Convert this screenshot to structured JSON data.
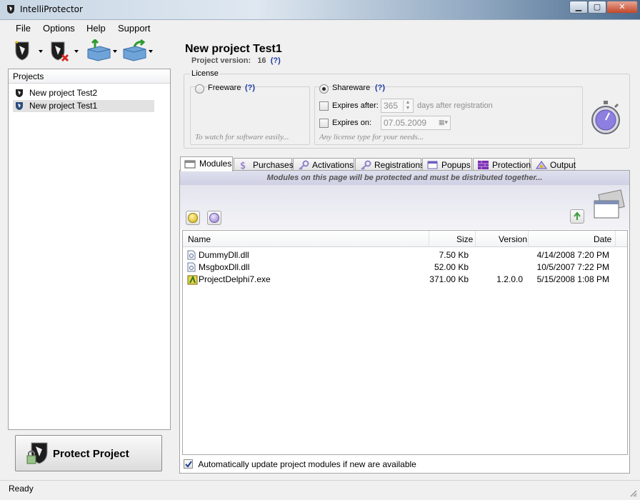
{
  "window": {
    "title": "IntelliProtector",
    "min_glyph": "▁",
    "max_glyph": "▢",
    "close_glyph": "✕"
  },
  "menu": [
    "File",
    "Options",
    "Help",
    "Support"
  ],
  "toolbar": {
    "icons": [
      "new-project-icon",
      "remove-project-icon",
      "open-project-icon",
      "save-project-icon"
    ]
  },
  "projects": {
    "header": "Projects",
    "items": [
      {
        "label": "New project Test2",
        "selected": false
      },
      {
        "label": "New project Test1",
        "selected": true
      }
    ]
  },
  "protect_button": "Protect Project",
  "project": {
    "title": "New project Test1",
    "version_label": "Project version:",
    "version_value": "16",
    "help": "(?)"
  },
  "license": {
    "title": "License",
    "freeware": {
      "label": "Freeware",
      "help": "(?)",
      "note": "To watch for software easily...",
      "selected": false
    },
    "shareware": {
      "label": "Shareware",
      "help": "(?)",
      "selected": true,
      "expires_after_label": "Expires after:",
      "expires_after_value": "365",
      "expires_after_suffix": "days after  registration",
      "expires_on_label": "Expires on:",
      "expires_on_value": "07.05.2009",
      "note": "Any license type for your needs..."
    }
  },
  "tabs": [
    {
      "label": "Modules",
      "icon": "modules-icon",
      "active": true
    },
    {
      "label": "Purchases",
      "icon": "dollar-icon",
      "active": false
    },
    {
      "label": "Activations",
      "icon": "key-icon",
      "active": false
    },
    {
      "label": "Registrations",
      "icon": "key-icon",
      "active": false
    },
    {
      "label": "Popups",
      "icon": "popup-window-icon",
      "active": false
    },
    {
      "label": "Protection",
      "icon": "wall-icon",
      "active": false
    },
    {
      "label": "Output",
      "icon": "output-icon",
      "active": false
    }
  ],
  "modules": {
    "banner": "Modules on this page will be protected and must be distributed together...",
    "columns": {
      "name": "Name",
      "size": "Size",
      "version": "Version",
      "date": "Date"
    },
    "rows": [
      {
        "name": "DummyDll.dll",
        "size": "7.50 Kb",
        "version": "",
        "date": "4/14/2008 7:20 PM",
        "icon": "dll-file-icon"
      },
      {
        "name": "MsgboxDll.dll",
        "size": "52.00 Kb",
        "version": "",
        "date": "10/5/2007 7:22 PM",
        "icon": "dll-file-icon"
      },
      {
        "name": "ProjectDelphi7.exe",
        "size": "371.00 Kb",
        "version": "1.2.0.0",
        "date": "5/15/2008 1:08 PM",
        "icon": "delphi-exe-icon"
      }
    ],
    "auto_update": {
      "label": "Automatically update project modules if new are available",
      "checked": true
    }
  },
  "status": "Ready"
}
